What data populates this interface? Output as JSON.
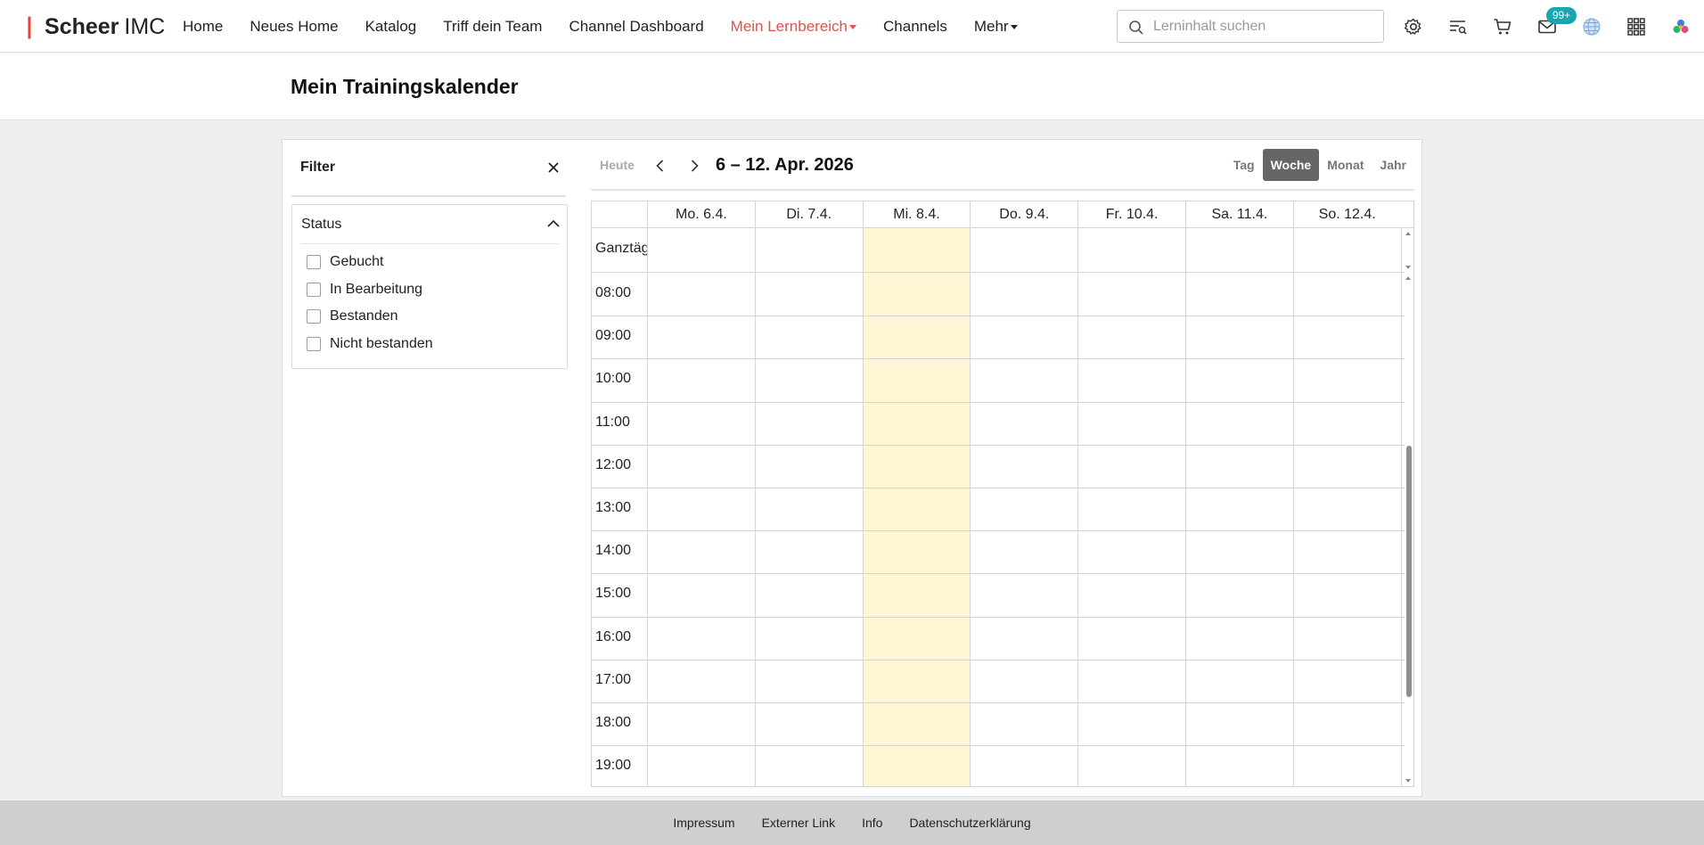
{
  "brand": {
    "name_bold": "Scheer",
    "name_rest": "IMC"
  },
  "nav": {
    "items": [
      {
        "label": "Home"
      },
      {
        "label": "Neues Home"
      },
      {
        "label": "Katalog"
      },
      {
        "label": "Triff dein Team"
      },
      {
        "label": "Channel Dashboard"
      },
      {
        "label": "Mein Lernbereich",
        "active": true,
        "dropdown": true
      },
      {
        "label": "Channels"
      },
      {
        "label": "Mehr",
        "dropdown": true
      }
    ]
  },
  "search": {
    "placeholder": "Lerninhalt suchen",
    "value": ""
  },
  "header_icons": [
    "gear-icon",
    "list-search-icon",
    "cart-icon",
    "mail-icon",
    "globe-icon",
    "apps-grid-icon",
    "user-avatar-icon"
  ],
  "notifications": {
    "badge": "99+"
  },
  "page": {
    "title": "Mein Trainingskalender"
  },
  "filter": {
    "title": "Filter",
    "status": {
      "label": "Status",
      "options": [
        {
          "label": "Gebucht",
          "checked": false
        },
        {
          "label": "In Bearbeitung",
          "checked": false
        },
        {
          "label": "Bestanden",
          "checked": false
        },
        {
          "label": "Nicht bestanden",
          "checked": false
        }
      ]
    }
  },
  "calendar": {
    "today_label": "Heute",
    "range": "6 – 12. Apr. 2026",
    "views": [
      {
        "label": "Tag",
        "active": false
      },
      {
        "label": "Woche",
        "active": true
      },
      {
        "label": "Monat",
        "active": false
      },
      {
        "label": "Jahr",
        "active": false
      }
    ],
    "days": [
      "Mo. 6.4.",
      "Di. 7.4.",
      "Mi. 8.4.",
      "Do. 9.4.",
      "Fr. 10.4.",
      "Sa. 11.4.",
      "So. 12.4."
    ],
    "today_index": 2,
    "allday_label": "Ganztägig",
    "hours": [
      "08:00",
      "09:00",
      "10:00",
      "11:00",
      "12:00",
      "13:00",
      "14:00",
      "15:00",
      "16:00",
      "17:00",
      "18:00",
      "19:00"
    ]
  },
  "footer": {
    "links": [
      "Impressum",
      "Externer Link",
      "Info",
      "Datenschutzerklärung"
    ]
  },
  "colors": {
    "accent": "#e2524a",
    "badge": "#1aa6b0",
    "today_highlight": "#fff6d6",
    "active_view": "#666666"
  }
}
